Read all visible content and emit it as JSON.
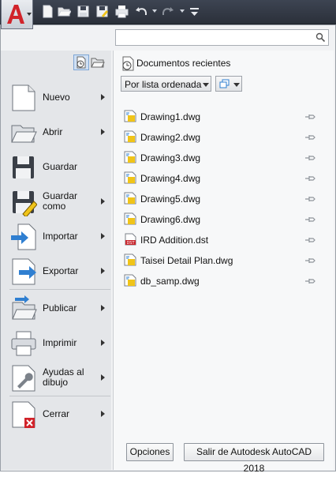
{
  "app": {
    "logo_letter": "A"
  },
  "quick_access": [
    {
      "name": "new-icon"
    },
    {
      "name": "open-icon"
    },
    {
      "name": "save-icon"
    },
    {
      "name": "saveas-icon"
    },
    {
      "name": "print-icon"
    },
    {
      "name": "undo-icon"
    },
    {
      "name": "redo-icon"
    },
    {
      "name": "customize-icon"
    }
  ],
  "search": {
    "placeholder": "",
    "value": ""
  },
  "left_menu": [
    {
      "label": "Nuevo",
      "icon": "new-doc-icon",
      "submenu": true
    },
    {
      "label": "Abrir",
      "icon": "open-folder-icon",
      "submenu": true
    },
    {
      "label": "Guardar",
      "icon": "save-disk-icon",
      "submenu": false
    },
    {
      "label": "Guardar\ncomo",
      "icon": "save-as-disk-icon",
      "submenu": true
    },
    {
      "label": "Importar",
      "icon": "import-icon",
      "submenu": true
    },
    {
      "label": "Exportar",
      "icon": "export-icon",
      "submenu": true
    },
    {
      "label": "Publicar",
      "icon": "publish-icon",
      "submenu": true
    },
    {
      "label": "Imprimir",
      "icon": "printer-icon",
      "submenu": true
    },
    {
      "label": "Ayudas al\ndibujo",
      "icon": "wrench-icon",
      "submenu": true
    },
    {
      "label": "Cerrar",
      "icon": "close-doc-icon",
      "submenu": true
    }
  ],
  "recent": {
    "title": "Documentos recientes",
    "sort_label": "Por lista ordenada",
    "files": [
      {
        "name": "Drawing1.dwg",
        "type": "dwg"
      },
      {
        "name": "Drawing2.dwg",
        "type": "dwg"
      },
      {
        "name": "Drawing3.dwg",
        "type": "dwg"
      },
      {
        "name": "Drawing4.dwg",
        "type": "dwg"
      },
      {
        "name": "Drawing5.dwg",
        "type": "dwg"
      },
      {
        "name": "Drawing6.dwg",
        "type": "dwg"
      },
      {
        "name": "IRD Addition.dst",
        "type": "dst"
      },
      {
        "name": "Taisei Detail Plan.dwg",
        "type": "dwg"
      },
      {
        "name": "db_samp.dwg",
        "type": "dwg"
      }
    ]
  },
  "footer": {
    "options_label": "Opciones",
    "exit_label": "Salir de Autodesk AutoCAD 2018"
  },
  "colors": {
    "logo_red": "#d1232a",
    "accent_blue": "#2f7fd1",
    "dwg_yellow": "#f0c419"
  }
}
